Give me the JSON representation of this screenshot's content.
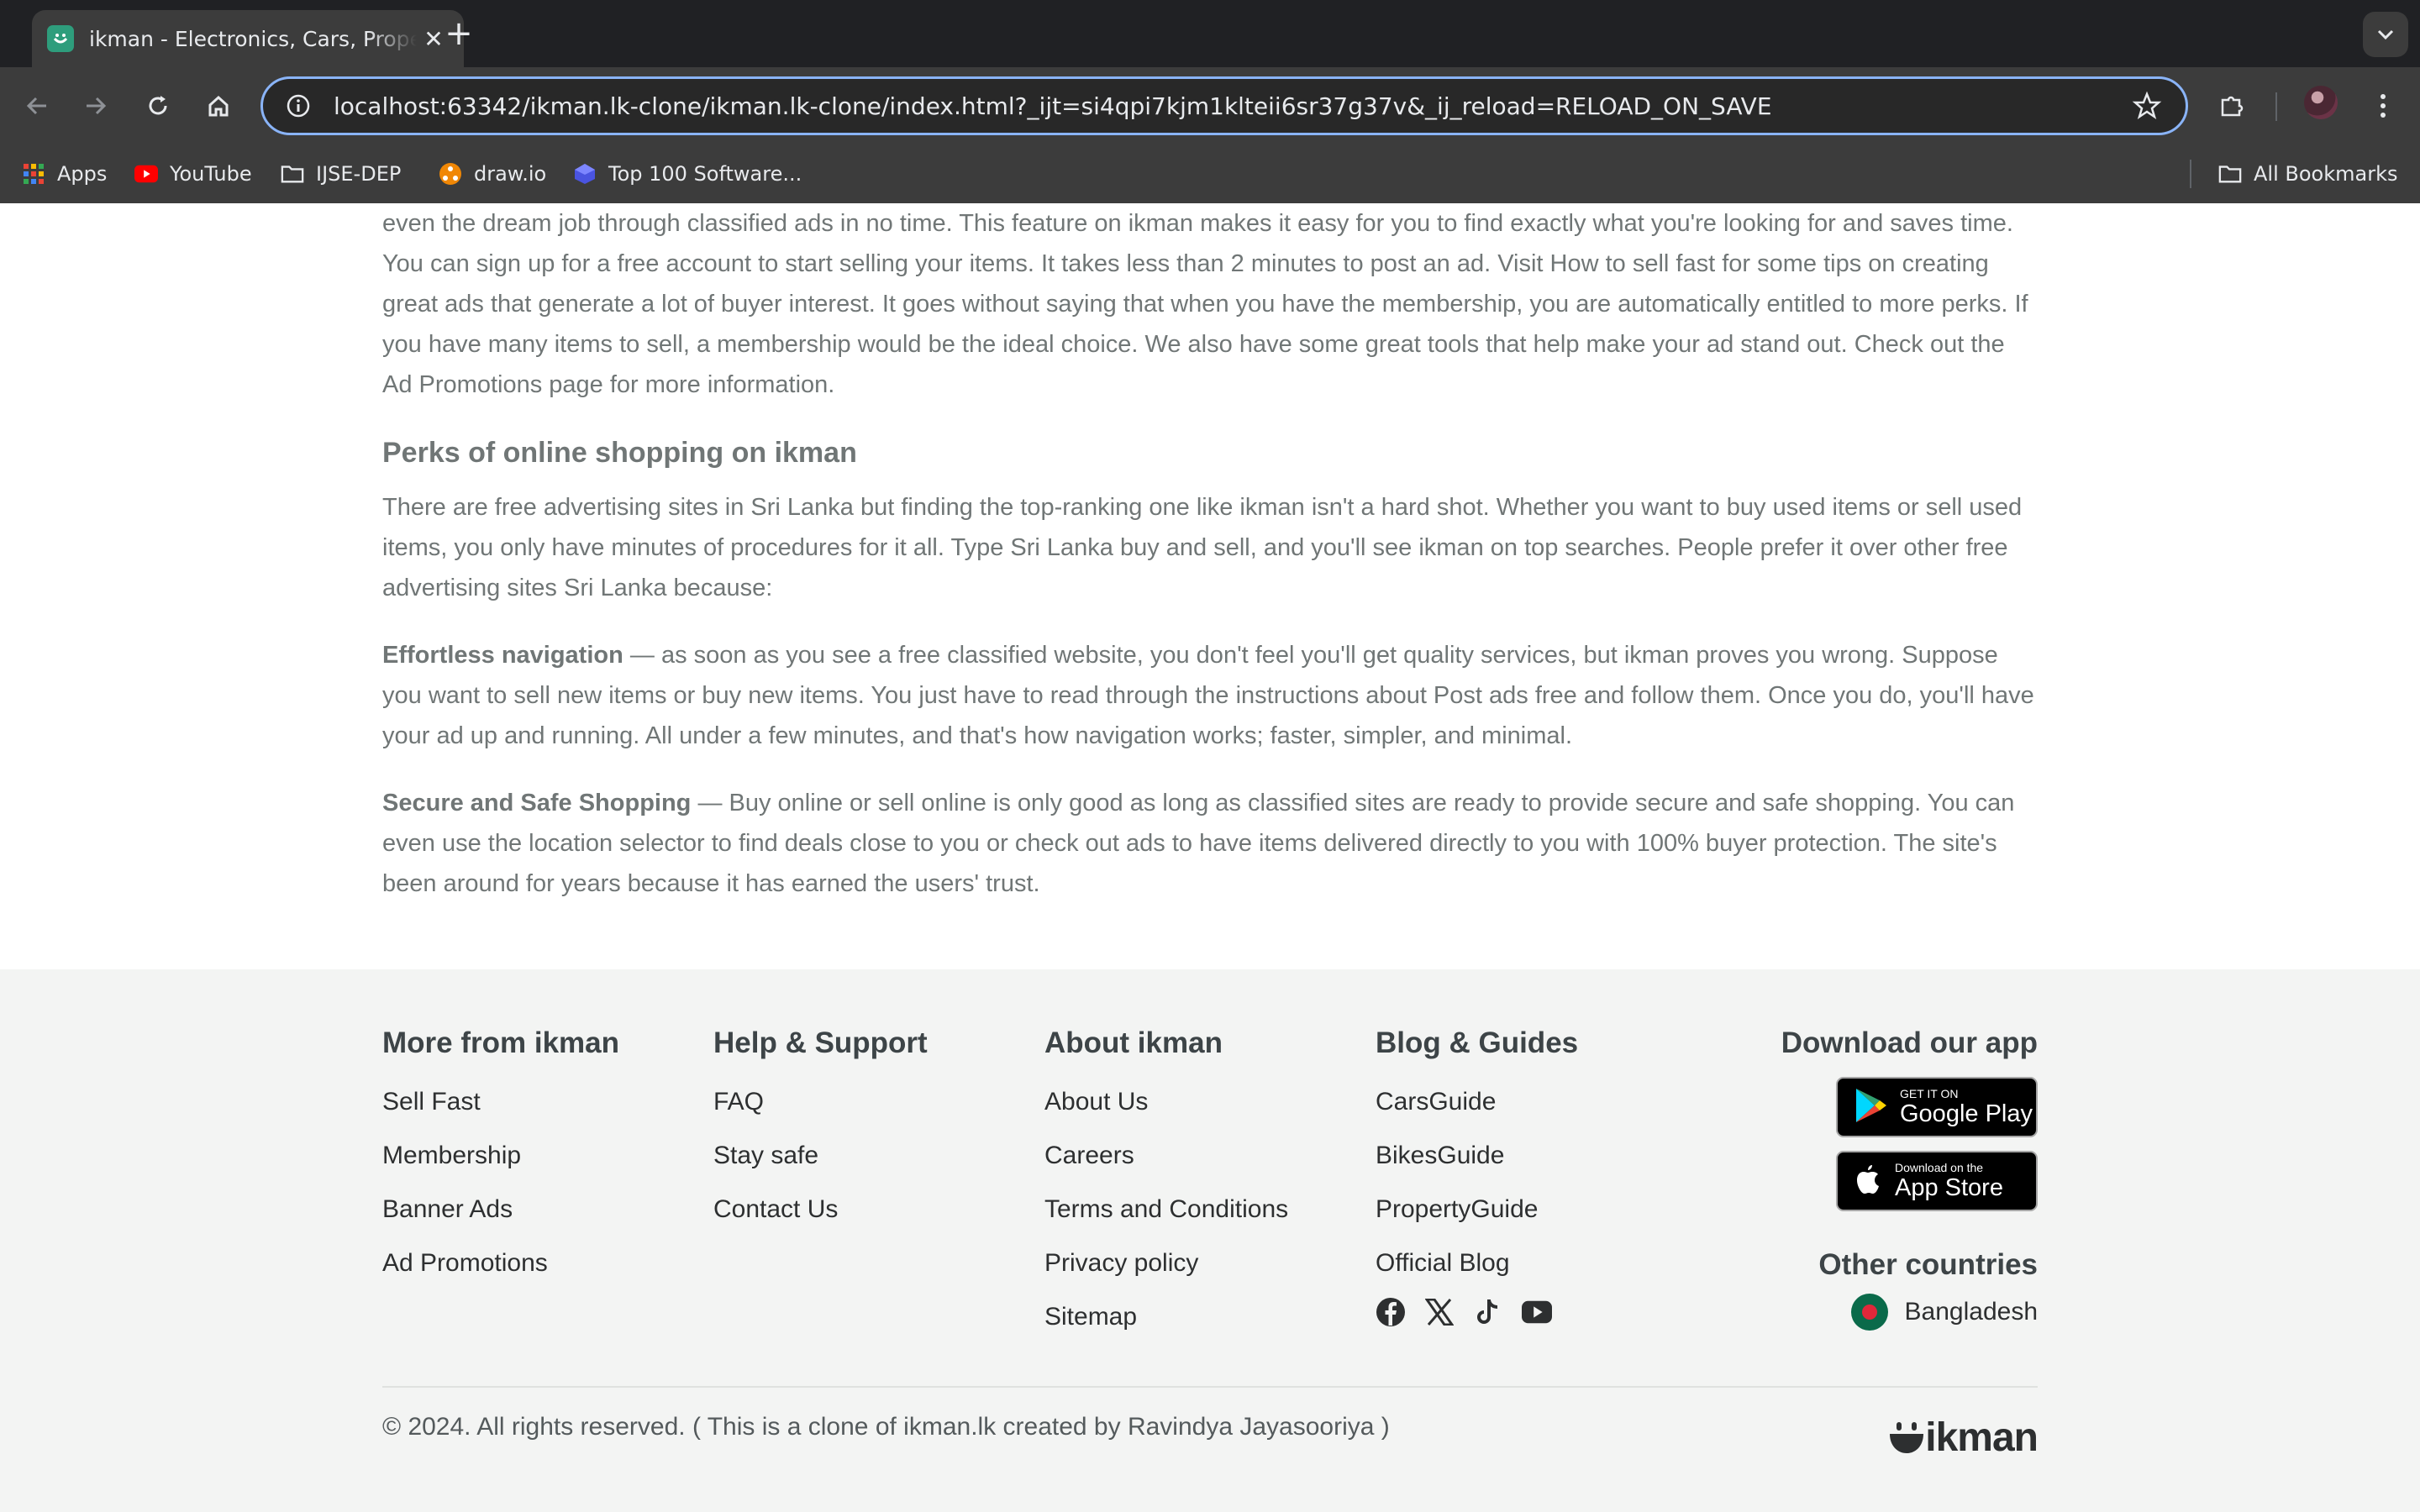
{
  "browser": {
    "tab_title": "ikman - Electronics, Cars, Property",
    "tab_close": "✕",
    "new_tab": "+",
    "url": "localhost:63342/ikman.lk-clone/ikman.lk-clone/index.html?_ijt=si4qpi7kjm1klteii6sr37g37v&_ij_reload=RELOAD_ON_SAVE",
    "bookmarks": [
      "Apps",
      "YouTube",
      "IJSE-DEP",
      "draw.io",
      "Top 100 Software..."
    ],
    "all_bookmarks": "All Bookmarks",
    "colors": {
      "frame": "#3c3c3c",
      "tabstrip": "#202124",
      "focus_ring": "#8ab4f8"
    }
  },
  "content": {
    "intro_text": "of products, from electronics and used cars to fashion and more. Connect with sellers directly to find great deals on used items, pets, cars, properties. Or even the dream job through classified ads in no time. This feature on ikman makes it easy for you to find exactly what you're looking for and saves time. You can sign up for a free account to start selling your items. It takes less than 2 minutes to post an ad. Visit How to sell fast for some tips on creating great ads that generate a lot of buyer interest. It goes without saying that when you have the membership, you are automatically entitled to more perks. If you have many items to sell, a membership would be the ideal choice. We also have some great tools that help make your ad stand out. Check out the Ad Promotions page for more information.",
    "section_title": "Perks of online shopping on ikman",
    "section_text": "There are free advertising sites in Sri Lanka but finding the top-ranking one like ikman isn't a hard shot. Whether you want to buy used items or sell used items, you only have minutes of procedures for it all. Type Sri Lanka buy and sell, and you'll see ikman on top searches. People prefer it over other free advertising sites Sri Lanka because:",
    "nav_label": "Effortless navigation",
    "nav_text": " — as soon as you see a free classified website, you don't feel you'll get quality services, but ikman proves you wrong. Suppose you want to sell new items or buy new items. You just have to read through the instructions about Post ads free and follow them. Once you do, you'll have your ad up and running. All under a few minutes, and that's how navigation works; faster, simpler, and minimal.",
    "safe_label": "Secure and Safe Shopping",
    "safe_text": " — Buy online or sell online is only good as long as classified sites are ready to provide secure and safe shopping. You can even use the location selector to find deals close to you or check out ads to have items delivered directly to you with 100% buyer protection. The site's been around for years because it has earned the users' trust."
  },
  "footer": {
    "more": {
      "title": "More from ikman",
      "links": [
        "Sell Fast",
        "Membership",
        "Banner Ads",
        "Ad Promotions"
      ]
    },
    "help": {
      "title": "Help & Support",
      "links": [
        "FAQ",
        "Stay safe",
        "Contact Us"
      ]
    },
    "about": {
      "title": "About ikman",
      "links": [
        "About Us",
        "Careers",
        "Terms and Conditions",
        "Privacy policy",
        "Sitemap"
      ]
    },
    "blog": {
      "title": "Blog & Guides",
      "links": [
        "CarsGuide",
        "BikesGuide",
        "PropertyGuide",
        "Official Blog"
      ]
    },
    "app": {
      "title": "Download our app",
      "google_small": "GET IT ON",
      "google_big": "Google Play",
      "apple_small": "Download on the",
      "apple_big": "App Store"
    },
    "other_countries": {
      "title": "Other countries",
      "country": "Bangladesh"
    },
    "copyright": "© 2024. All rights reserved. ( This is a clone of ikman.lk created by Ravindya Jayasooriya )",
    "logo": "ikman",
    "colors": {
      "background": "#f3f4f3",
      "brand": "#2d2f30"
    }
  }
}
